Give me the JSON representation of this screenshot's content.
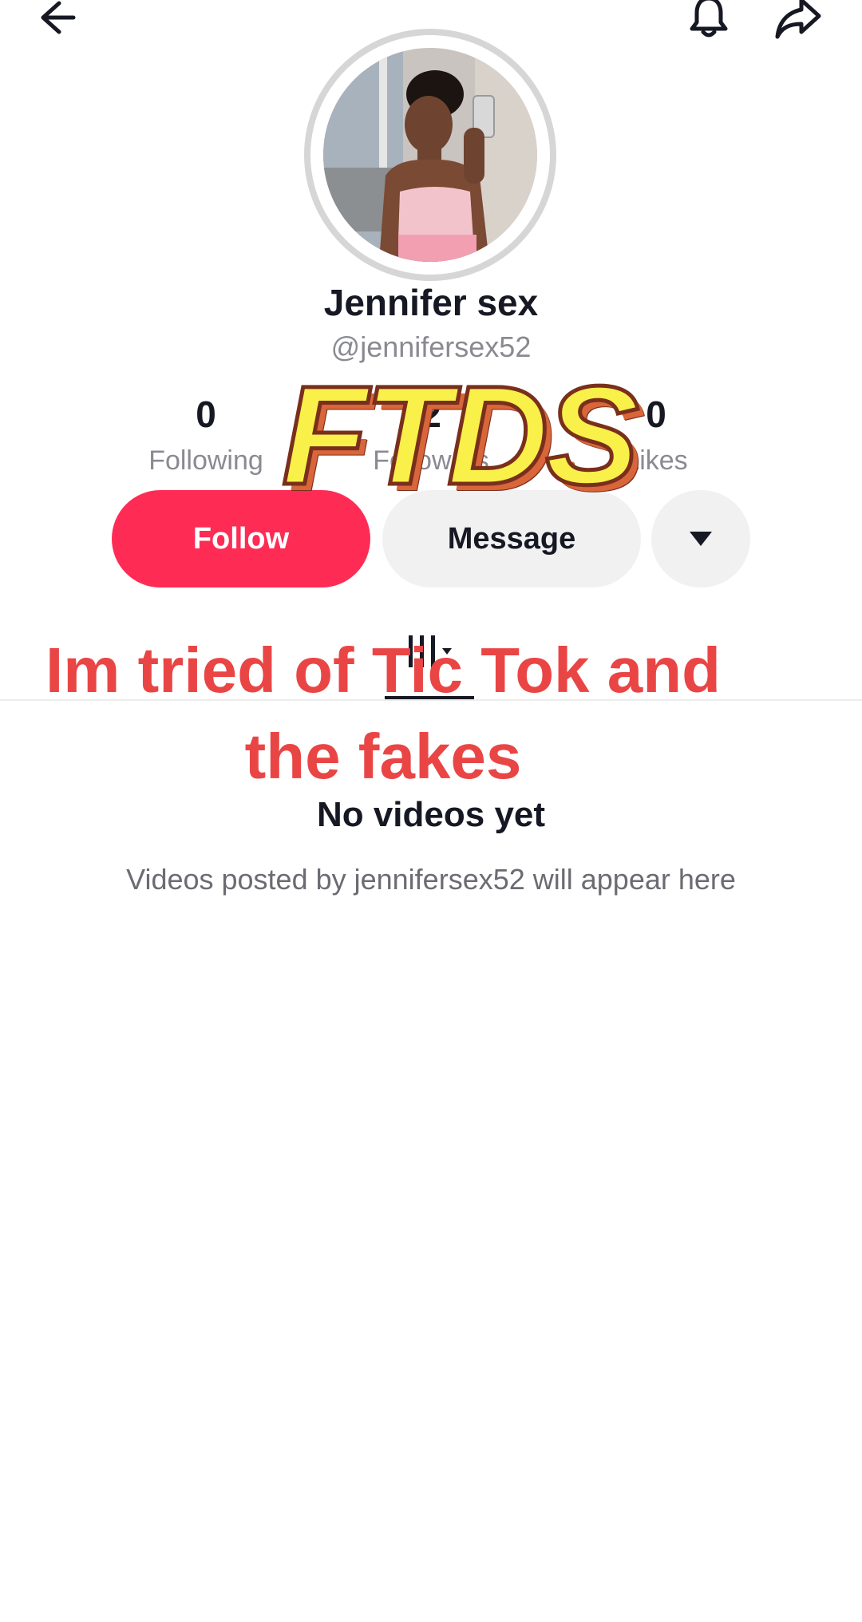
{
  "top_bar": {
    "back_icon": "arrow-left-icon",
    "notification_icon": "bell-icon",
    "share_icon": "share-arrow-icon"
  },
  "profile": {
    "display_name": "Jennifer sex",
    "handle": "@jennifersex52",
    "avatar": "profile-photo"
  },
  "stats": [
    {
      "value": "0",
      "label": "Following"
    },
    {
      "value": "2",
      "label": "Followers"
    },
    {
      "value": "0",
      "label": "Likes"
    }
  ],
  "actions": {
    "follow_label": "Follow",
    "message_label": "Message",
    "more_icon": "caret-down-icon"
  },
  "tabs": {
    "videos_icon": "grid-icon"
  },
  "empty_state": {
    "title": "No videos yet",
    "description": "Videos posted by jennifersex52 will appear here"
  },
  "overlay": {
    "sticker_text": "FTDS",
    "caption": "Im tried of Tic Tok and the fakes"
  },
  "colors": {
    "accent": "#fe2c55",
    "caption": "#ea4545",
    "sticker_fill": "#f9f04a"
  }
}
